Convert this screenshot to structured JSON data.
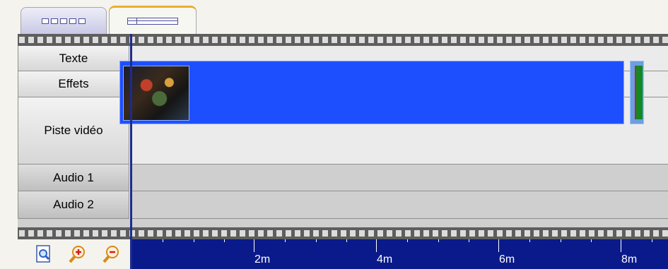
{
  "tabs": [
    {
      "name": "storyboard",
      "icon": "storyboard-icon"
    },
    {
      "name": "timeline",
      "icon": "timeline-icon",
      "active": true
    }
  ],
  "tracks": [
    {
      "label": "Texte"
    },
    {
      "label": "Effets"
    },
    {
      "label": "Piste vidéo"
    },
    {
      "label": "Audio 1"
    },
    {
      "label": "Audio 2"
    }
  ],
  "toolbar": {
    "buttons": [
      {
        "icon": "zoom-fit-icon"
      },
      {
        "icon": "zoom-in-icon"
      },
      {
        "icon": "zoom-out-icon"
      }
    ]
  },
  "ruler": {
    "labels": [
      "2m",
      "4m",
      "6m",
      "8m"
    ]
  },
  "colors": {
    "clip": "#1e4fff",
    "ruler": "#0a1a8a",
    "playhead": "#1c2c8c",
    "active_tab_accent": "#ebad2f"
  }
}
